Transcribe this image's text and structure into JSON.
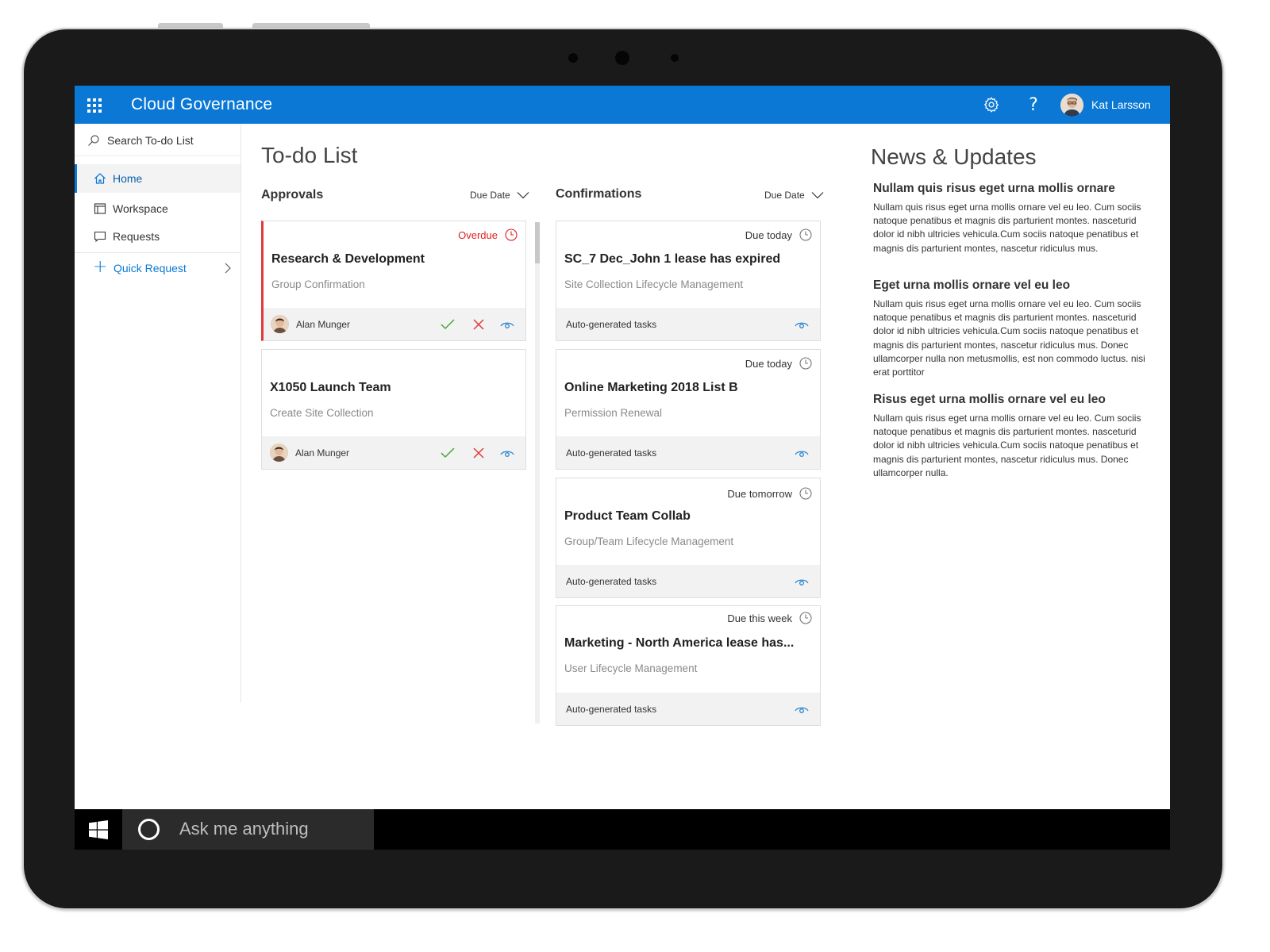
{
  "app": {
    "title": "Cloud Governance",
    "accent_color": "#0a78d4",
    "icons": [
      "app-launcher-icon",
      "settings-gear-icon",
      "help-icon"
    ]
  },
  "user": {
    "name": "Kat Larsson"
  },
  "sidebar": {
    "search_placeholder": "Search To-do List",
    "items": [
      {
        "label": "Home",
        "icon": "home-icon",
        "active": true
      },
      {
        "label": "Workspace",
        "icon": "workspace-icon",
        "active": false
      },
      {
        "label": "Requests",
        "icon": "requests-icon",
        "active": false
      }
    ],
    "quick_request": "Quick Request"
  },
  "todo": {
    "title": "To-do List",
    "approvals": {
      "title": "Approvals",
      "sort_label": "Due Date",
      "cards": [
        {
          "status": "Overdue",
          "status_color": "#e21e1e",
          "title": "Research & Development",
          "subtitle": "Group Confirmation",
          "assignee": "Alan Munger"
        },
        {
          "status": "",
          "title": "X1050 Launch Team",
          "subtitle": "Create Site Collection",
          "assignee": "Alan Munger"
        }
      ]
    },
    "confirmations": {
      "title": "Confirmations",
      "sort_label": "Due Date",
      "cards": [
        {
          "status": "Due today",
          "title": "SC_7 Dec_John 1 lease has expired",
          "subtitle": "Site Collection Lifecycle Management",
          "footer": "Auto-generated tasks"
        },
        {
          "status": "Due today",
          "title": "Online Marketing 2018 List B",
          "subtitle": "Permission Renewal",
          "footer": "Auto-generated tasks"
        },
        {
          "status": "Due tomorrow",
          "title": "Product Team Collab",
          "subtitle": "Group/Team Lifecycle Management",
          "footer": "Auto-generated tasks"
        },
        {
          "status": "Due this week",
          "title": "Marketing - North America lease has...",
          "subtitle": "User Lifecycle Management",
          "footer": "Auto-generated tasks"
        }
      ]
    }
  },
  "news": {
    "title": "News & Updates",
    "items": [
      {
        "heading": "Nullam quis risus eget urna mollis ornare",
        "body": "Nullam quis risus eget urna mollis ornare vel eu leo. Cum sociis natoque penatibus et magnis dis parturient montes. nasceturid dolor id nibh ultricies vehicula.Cum sociis natoque penatibus et magnis dis parturient montes, nascetur ridiculus mus."
      },
      {
        "heading": "Eget urna mollis ornare vel eu leo",
        "body": "Nullam quis risus eget urna mollis ornare vel eu leo. Cum sociis natoque penatibus et magnis dis parturient montes. nasceturid dolor id nibh ultricies vehicula.Cum sociis natoque penatibus et magnis dis parturient montes, nascetur ridiculus mus. Donec ullamcorper nulla non metusmollis, est non commodo luctus. nisi erat porttitor"
      },
      {
        "heading": "Risus eget urna mollis ornare vel eu leo",
        "body": "Nullam quis risus eget urna mollis ornare vel eu leo. Cum sociis natoque penatibus et magnis dis parturient montes. nasceturid dolor id nibh ultricies vehicula.Cum sociis natoque penatibus et magnis dis parturient montes, nascetur ridiculus mus. Donec ullamcorper nulla."
      }
    ]
  },
  "taskbar": {
    "search_placeholder": "Ask me anything"
  }
}
